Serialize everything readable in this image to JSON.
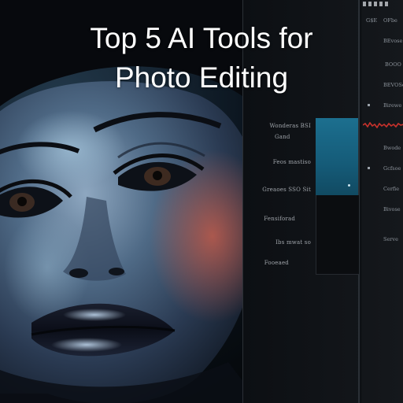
{
  "title": {
    "line1": "Top 5 AI Tools for",
    "line2": "Photo Editing"
  },
  "editor": {
    "labels": [
      "Wonderas BSI",
      "Gand",
      "Feos mastiso",
      "Greaoes SSO Sit",
      "Fensiforad",
      "Ibs mwat so",
      "Fooeaed"
    ],
    "right_column": [
      "G$E",
      "OFbe",
      "BEvose",
      "BOOO",
      "BEVOSe",
      "Birewe",
      "Bwode",
      "Gcfsoe",
      "Cerfie",
      "Bivose",
      "Serve"
    ]
  },
  "colors": {
    "accent_teal": "#1c6f8f",
    "signal_red": "#c8322c",
    "title_text": "#ffffff"
  }
}
